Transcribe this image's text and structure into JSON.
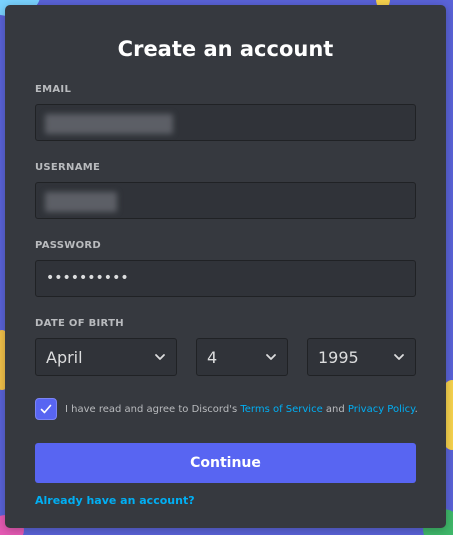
{
  "form": {
    "title": "Create an account",
    "email_label": "EMAIL",
    "username_label": "USERNAME",
    "password_label": "PASSWORD",
    "password_value": "••••••••••",
    "dob_label": "DATE OF BIRTH",
    "dob_month": "April",
    "dob_day": "4",
    "dob_year": "1995",
    "agree_prefix": "I have read and agree to Discord's ",
    "terms_link": "Terms of Service",
    "agree_and": " and ",
    "privacy_link": "Privacy Policy",
    "agree_suffix": ".",
    "continue_label": "Continue",
    "login_link": "Already have an account?"
  },
  "colors": {
    "card_bg": "#36393f",
    "input_bg": "#303339",
    "accent": "#5865f2",
    "link": "#00aff4",
    "label": "#b9bbbe"
  },
  "icons": {
    "select_chevron": "chevron-down-icon",
    "checkbox_check": "check-icon"
  }
}
